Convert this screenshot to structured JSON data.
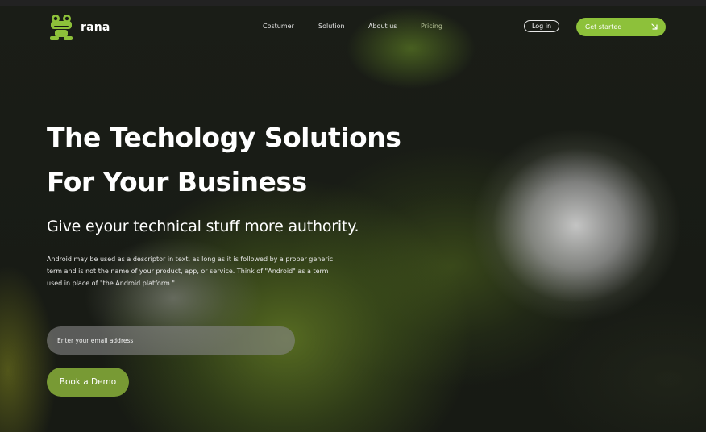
{
  "brand": {
    "name": "rana",
    "logo_icon": "frog-icon"
  },
  "nav": {
    "items": [
      {
        "label": "Costumer"
      },
      {
        "label": "Solution"
      },
      {
        "label": "About us"
      },
      {
        "label": "Pricing"
      }
    ]
  },
  "header": {
    "login_label": "Log in",
    "get_started_label": "Get started",
    "get_started_icon": "arrow-down-right-icon"
  },
  "hero": {
    "title_line1": "The Techology Solutions",
    "title_line2": "For Your Business",
    "subtitle": "Give eyour technical stuff more authority.",
    "description": "Android may be used as a descriptor in text, as long as it is followed by a proper generic term and is not the name of your product, app, or service. Think of \"Android\" as a term used in place of \"the Android platform.\""
  },
  "form": {
    "email_placeholder": "Enter your email address",
    "email_value": "",
    "demo_button_label": "Book a Demo"
  },
  "colors": {
    "accent": "#8dc13a",
    "demo_button": "#789a34",
    "background": "#161813"
  }
}
